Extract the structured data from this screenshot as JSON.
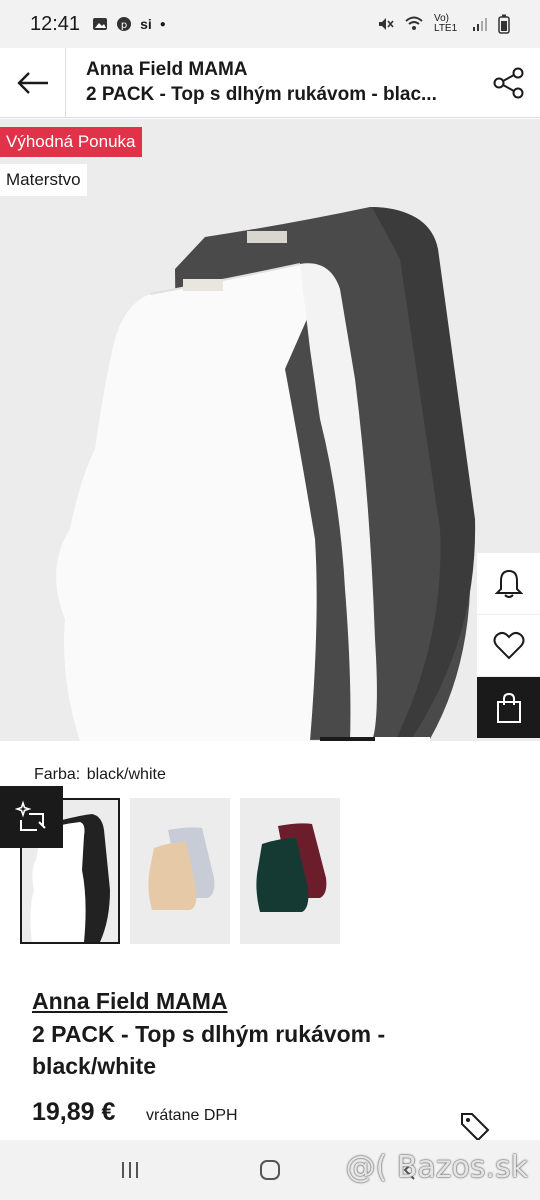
{
  "status_bar": {
    "time": "12:41",
    "network": "Vo) LTE1",
    "icons": [
      "image-icon",
      "pinterest-icon",
      "si-icon",
      "dot-icon",
      "mute-icon",
      "wifi-icon",
      "signal-icon",
      "battery-icon"
    ]
  },
  "header": {
    "brand": "Anna Field MAMA",
    "product": "2 PACK - Top s dlhým rukávom - blac..."
  },
  "gallery": {
    "badge_deal": "Výhodná Ponuka",
    "badge_category": "Materstvo",
    "deal_color": "#e0334a"
  },
  "color": {
    "label": "Farba:",
    "value": "black/white"
  },
  "product": {
    "brand": "Anna Field MAMA",
    "name": "2 PACK - Top s dlhým rukávom - black/white",
    "price": "19,89 €",
    "vat_note": "vrátane DPH"
  },
  "watermark": "@( Bazos.sk"
}
